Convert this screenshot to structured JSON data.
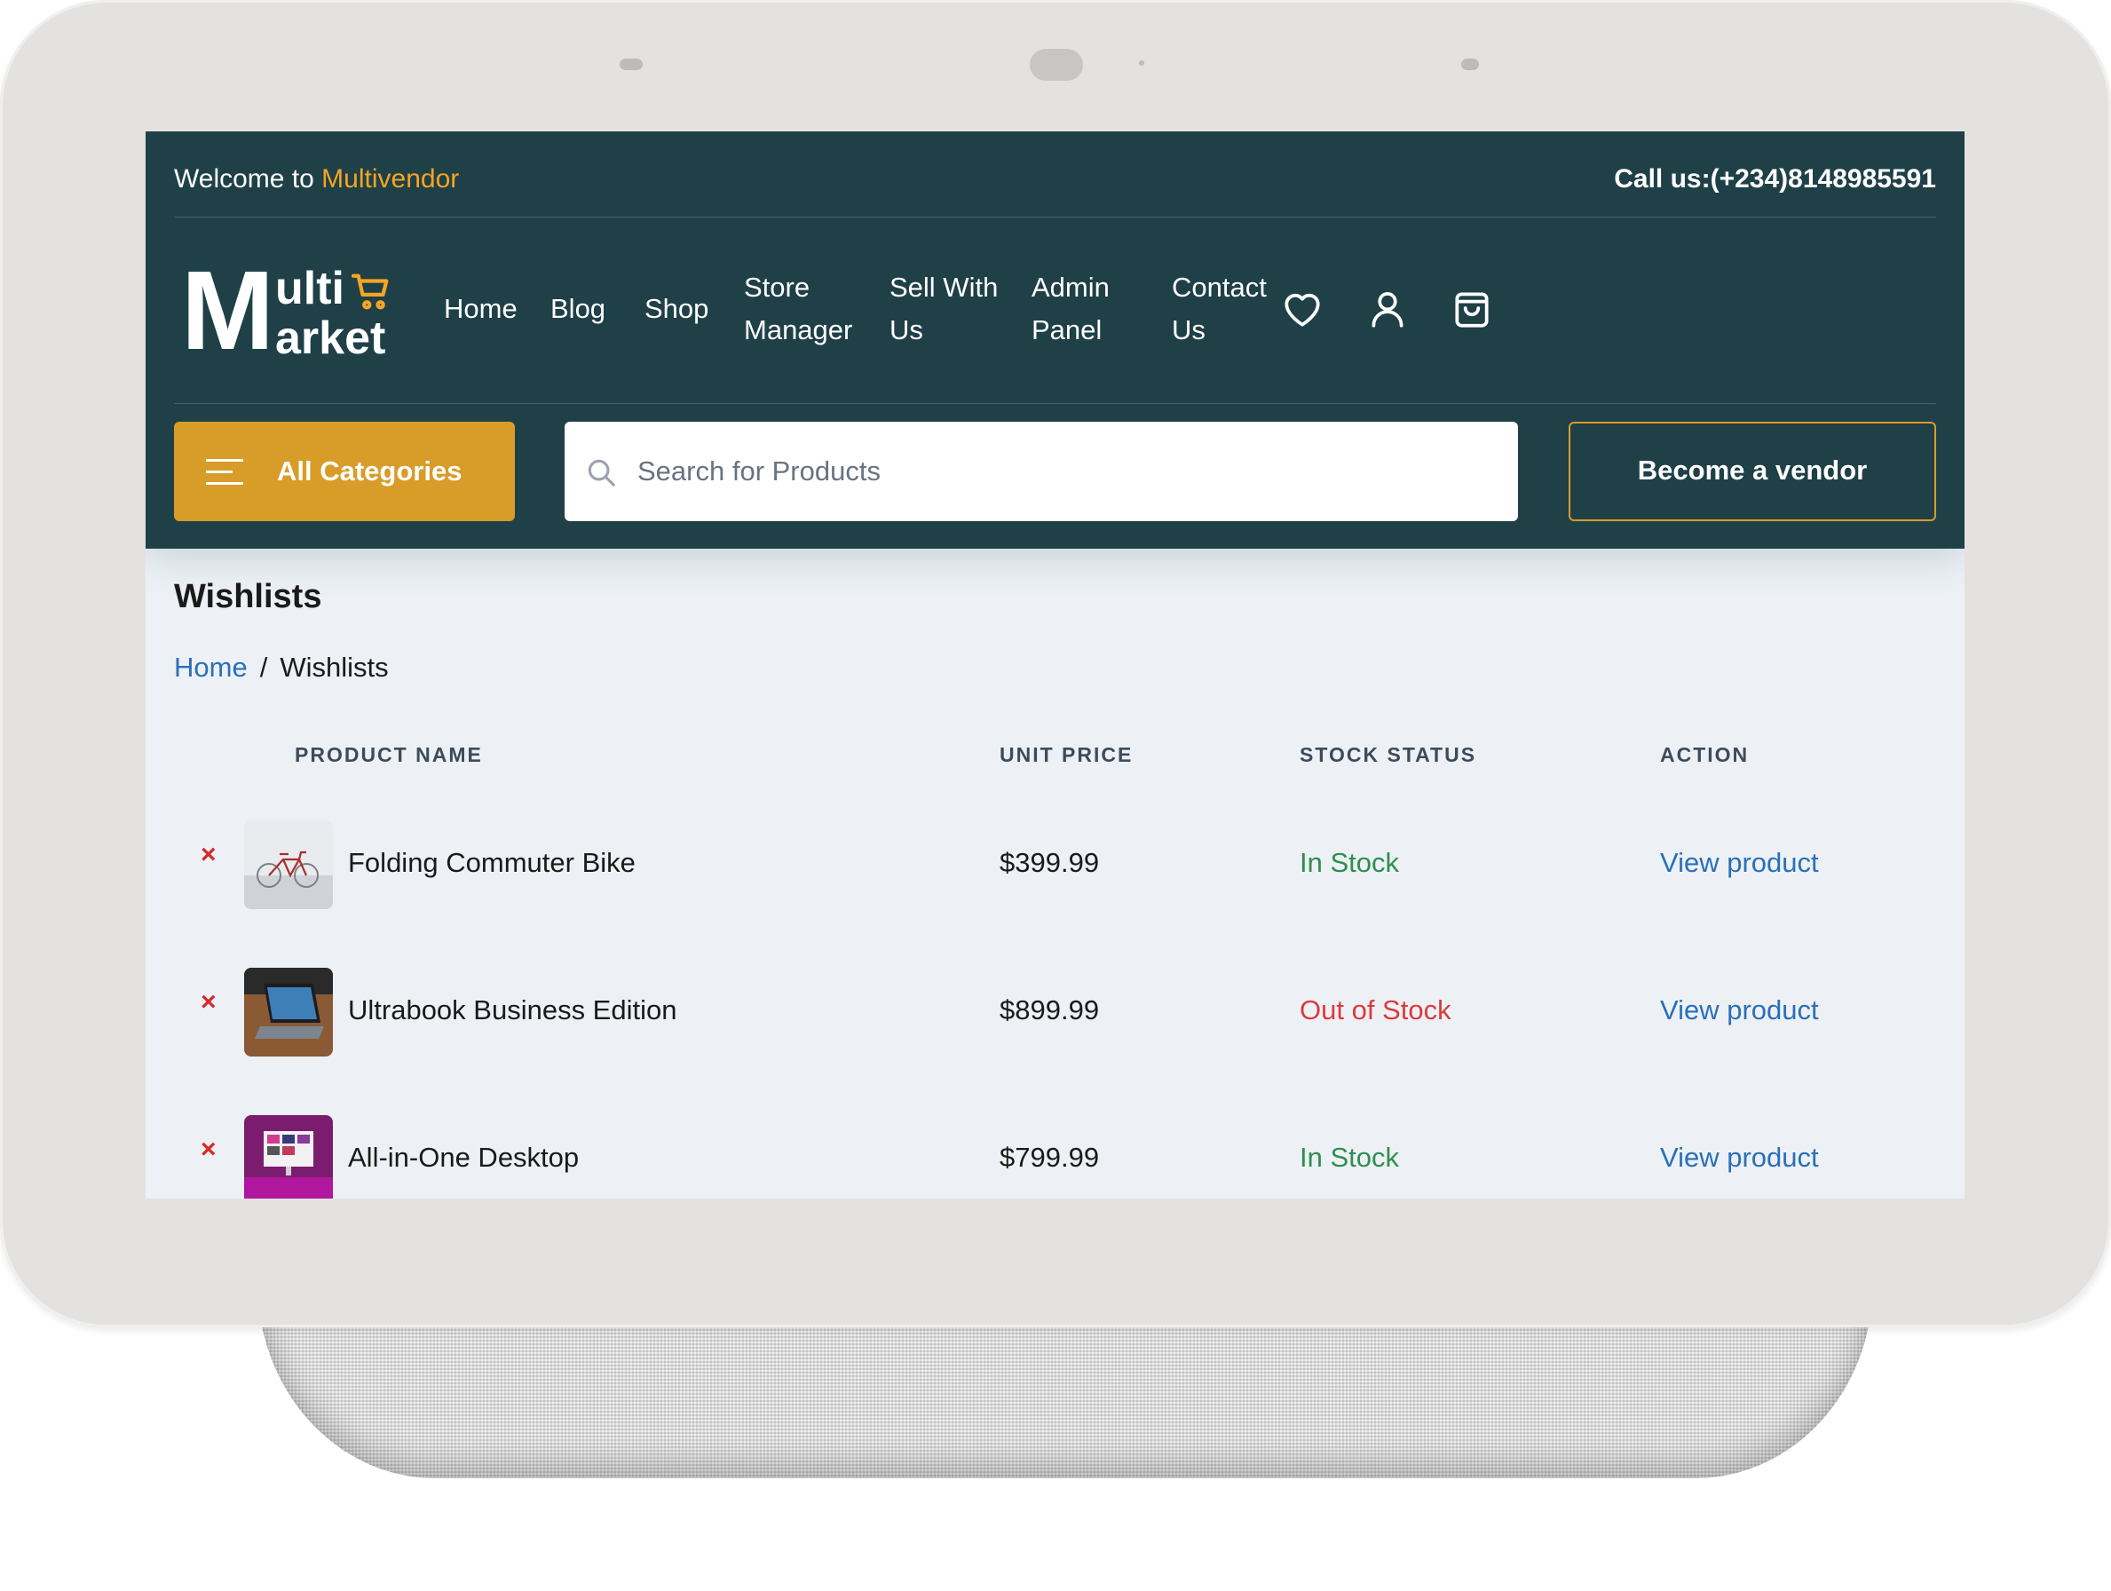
{
  "topbar": {
    "welcome_prefix": "Welcome to ",
    "brand": "Multivendor",
    "call": "Call us:(+234)8148985591"
  },
  "logo": {
    "big_letter": "M",
    "line1": "ulti",
    "line2": "arket",
    "icon": "cart-icon"
  },
  "nav": {
    "home": "Home",
    "blog": "Blog",
    "shop": "Shop",
    "store_manager_1": "Store",
    "store_manager_2": "Manager",
    "sell_1": "Sell With",
    "sell_2": "Us",
    "admin_1": "Admin",
    "admin_2": "Panel",
    "contact_1": "Contact",
    "contact_2": "Us",
    "icons": [
      "heart-icon",
      "user-icon",
      "bag-icon"
    ]
  },
  "subbar": {
    "categories_label": "All Categories",
    "search_placeholder": "Search for Products",
    "vendor_label": "Become a vendor"
  },
  "page": {
    "title": "Wishlists",
    "breadcrumb": {
      "home": "Home",
      "separator": "/",
      "current": "Wishlists"
    }
  },
  "table": {
    "headers": {
      "product": "PRODUCT NAME",
      "price": "UNIT PRICE",
      "stock": "STOCK STATUS",
      "action": "ACTION"
    },
    "rows": [
      {
        "remove": "×",
        "name": "Folding Commuter Bike",
        "price": "$399.99",
        "stock": "In Stock",
        "action": "View product"
      },
      {
        "remove": "×",
        "name": "Ultrabook Business Edition",
        "price": "$899.99",
        "stock": "Out of Stock",
        "action": "View product"
      },
      {
        "remove": "×",
        "name": "All-in-One Desktop",
        "price": "$799.99",
        "stock": "In Stock",
        "action": "View product"
      }
    ]
  },
  "colors": {
    "header_bg": "#1f4047",
    "accent": "#d89c28",
    "brand_text": "#f5a524",
    "in_stock": "#2f8f4e",
    "out_of_stock": "#d93b3b",
    "link": "#2a70b8",
    "content_bg": "#edf1f6"
  }
}
